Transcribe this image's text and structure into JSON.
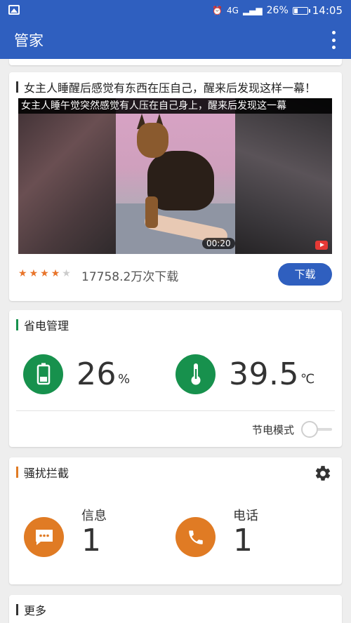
{
  "status_bar": {
    "network": "4G",
    "battery": "26%",
    "time": "14:05"
  },
  "app_bar": {
    "title": "管家"
  },
  "ad": {
    "title": "女主人睡醒后感觉有东西在压自己，醒来后发现这样一幕！",
    "caption": "女主人睡午觉突然感觉有人压在自己身上，醒来后发现这一幕",
    "duration": "00:20",
    "rating": 4,
    "rating_max": 5,
    "downloads": "17758.2万次下载",
    "download_button": "下载",
    "accent": "#2f5fbf"
  },
  "power": {
    "title": "省电管理",
    "battery_value": "26",
    "battery_unit": "%",
    "temperature_value": "39.5",
    "temperature_unit": "℃",
    "save_mode_label": "节电模式",
    "save_mode_on": false,
    "accent": "#17914d"
  },
  "harassment": {
    "title": "骚扰拦截",
    "messages_label": "信息",
    "messages_count": "1",
    "calls_label": "电话",
    "calls_count": "1",
    "accent": "#e07b24"
  },
  "more": {
    "title": "更多"
  }
}
